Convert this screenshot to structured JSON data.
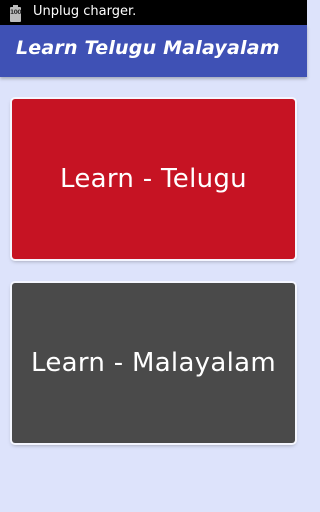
{
  "status_bar": {
    "battery_level": "100",
    "notification_text": "Unplug charger."
  },
  "app_bar": {
    "title": "Learn Telugu Malayalam"
  },
  "cards": [
    {
      "label": "Learn - Telugu",
      "color": "#c61323"
    },
    {
      "label": "Learn - Malayalam",
      "color": "#4a4a4a"
    }
  ],
  "colors": {
    "app_bar": "#3f51b5",
    "background": "#dde3fb",
    "status_bar": "#000000"
  }
}
